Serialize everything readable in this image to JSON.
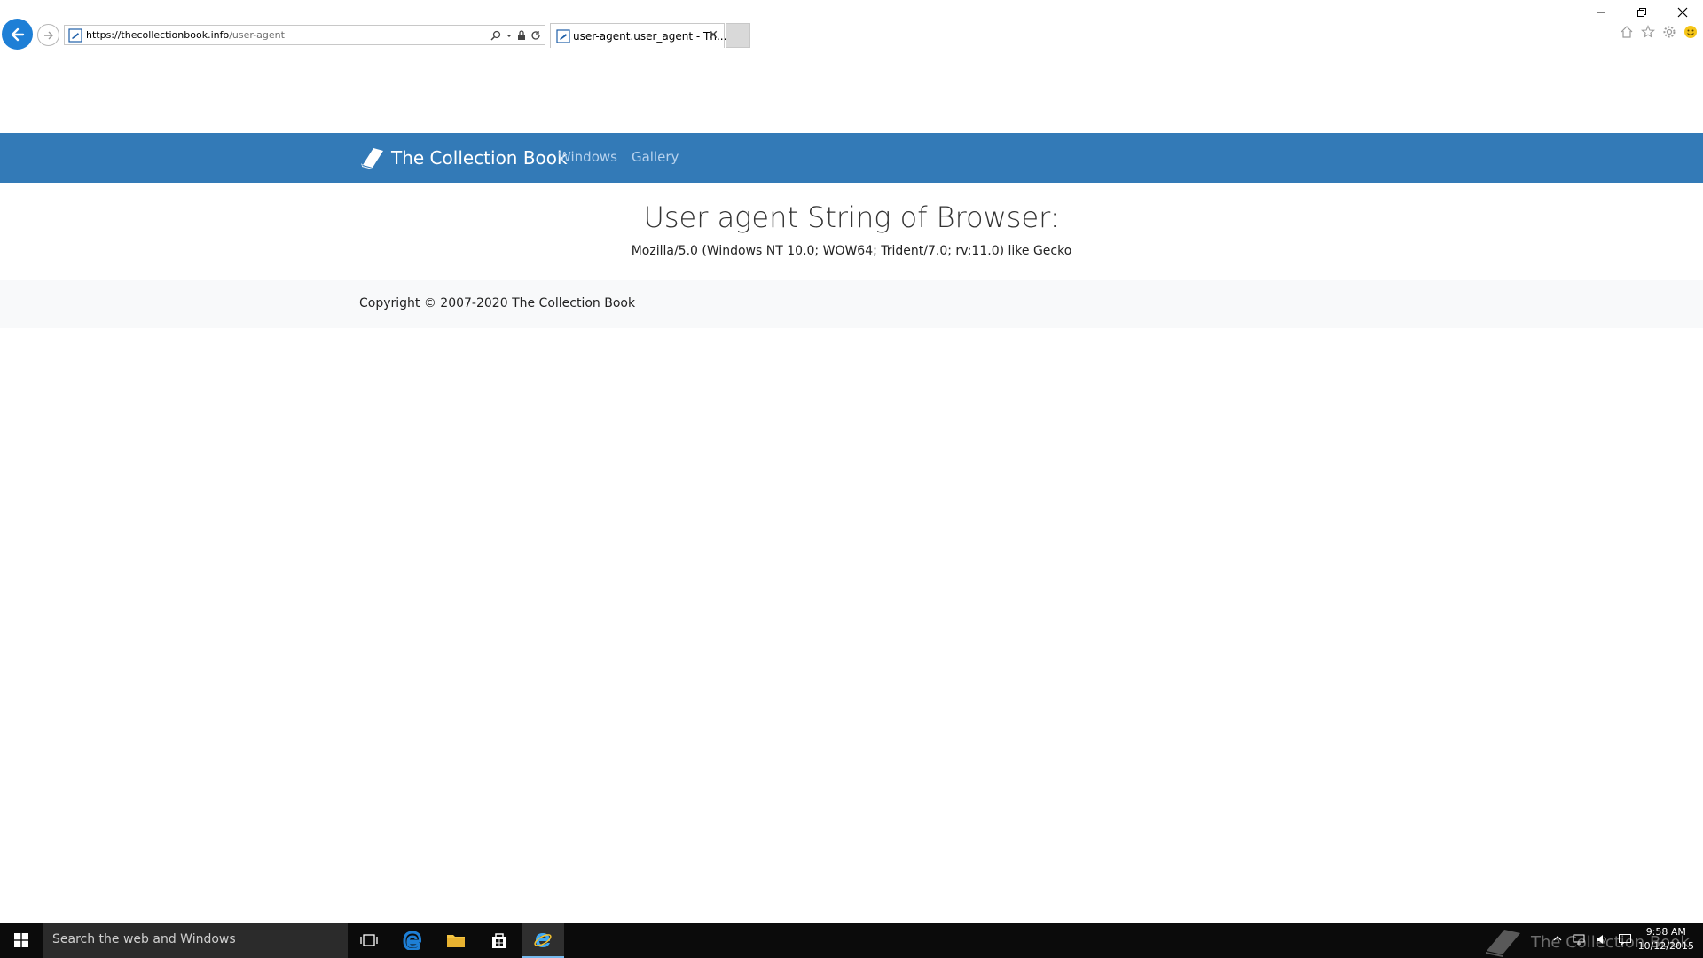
{
  "browser": {
    "url_host": "https://thecollectionbook.info",
    "url_path": "/user-agent",
    "tab_title": "user-agent.user_agent - Th...",
    "tab_close": "✕"
  },
  "site": {
    "brand": "The Collection Book",
    "nav": [
      "Windows",
      "Gallery"
    ],
    "heading": "User agent String of Browser:",
    "user_agent": "Mozilla/5.0 (Windows NT 10.0; WOW64; Trident/7.0; rv:11.0) like Gecko",
    "copyright": "Copyright © 2007-2020 The Collection Book",
    "brand_color": "#337ab7"
  },
  "taskbar": {
    "search_placeholder": "Search the web and Windows",
    "time": "9:58 AM",
    "date": "10/12/2015",
    "watermark": "The Collection Book"
  }
}
